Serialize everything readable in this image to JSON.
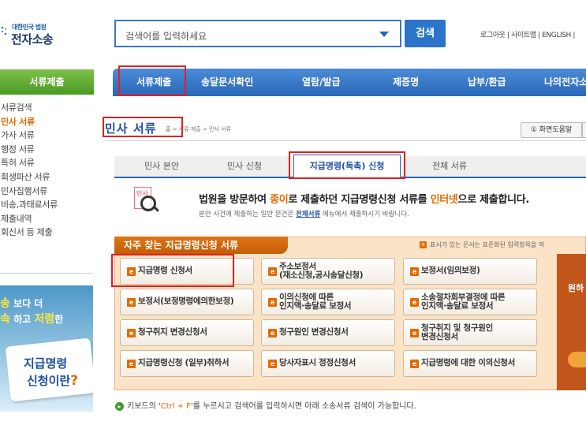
{
  "header": {
    "logo_top": "대한민국 법원",
    "logo_main": "전자소송",
    "search_placeholder": "검색어를 입력하세요",
    "search_button": "검색",
    "util_links": "로그아웃 | 사이트맵 | ENGLISH |"
  },
  "nav": {
    "items": [
      "서류제출",
      "송달문서확인",
      "열람/발급",
      "제증명",
      "납부/환급",
      "나의전자소"
    ]
  },
  "sidebar": {
    "header": "서류제출",
    "items": [
      "서류검색",
      "민사 서류",
      "가사 서류",
      "행정 서류",
      "특허 서류",
      "회생파산 서류",
      "민사집행서류",
      "비송,과태료서류",
      "제출내역",
      "회신서 등 제출"
    ],
    "active_index": 1
  },
  "promo": {
    "line1_a": "송",
    "line1_b": "보다 더",
    "line2_a": "속",
    "line2_b": "하고",
    "line2_c": "저렴",
    "line2_d": "한",
    "card_line1": "지급명령",
    "card_line2": "신청이란",
    "card_q": "?"
  },
  "page": {
    "title": "민사 서류",
    "breadcrumb": "홈 > 서류 제출 > 민사 서류",
    "help_button": "① 화면도움말"
  },
  "tabs": [
    "민사 본안",
    "민사 신청",
    "지급명령(독촉) 신청",
    "전체 서류"
  ],
  "intro": {
    "icon_label": "민사",
    "main_a": "법원을 방문하여 ",
    "main_b": "종이",
    "main_c": "로 제출하던 지급명령신청 서류를 ",
    "main_d": "인터넷",
    "main_e": "으로 제출합니다.",
    "sub_a": "본안 사건에 제출하는 일반 문건은 ",
    "sub_link": "전체서류",
    "sub_b": " 메뉴에서 제출하시기 바랍니다."
  },
  "forms": {
    "title": "자주 찾는 지급명령신청 서류",
    "note": "표시가 있는 문서는 표준화된 입력항목을 적",
    "e_badge": "e",
    "items": [
      "지급명령 신청서",
      "주소보정서\n(재소신청,공시송달신청)",
      "보정서(임의보정)",
      "보정서(보정명령에의한보정)",
      "이의신청에 따른\n인지액·송달료 보정서",
      "소송절차회부결정에 따른\n인지액·송달료 보정서",
      "청구취지 변경신청서",
      "청구원인 변경신청서",
      "청구취지 및 청구원인\n변경신청서",
      "지급명령신청 (일부)취하서",
      "당사자표시 정정신청서",
      "지급명령에 대한 이의신청서"
    ],
    "side_text": "원하"
  },
  "footer": {
    "a": "키보드의 '",
    "key": "Ctrl + F",
    "b": "'를 누르시고 검색어를 입력하시면 아래 소송서류 검색이 가능합니다."
  },
  "colors": {
    "accent_blue": "#2a68b8",
    "accent_orange": "#e26b00",
    "sidebar_green": "#5aa830",
    "highlight_red": "#e02020"
  }
}
